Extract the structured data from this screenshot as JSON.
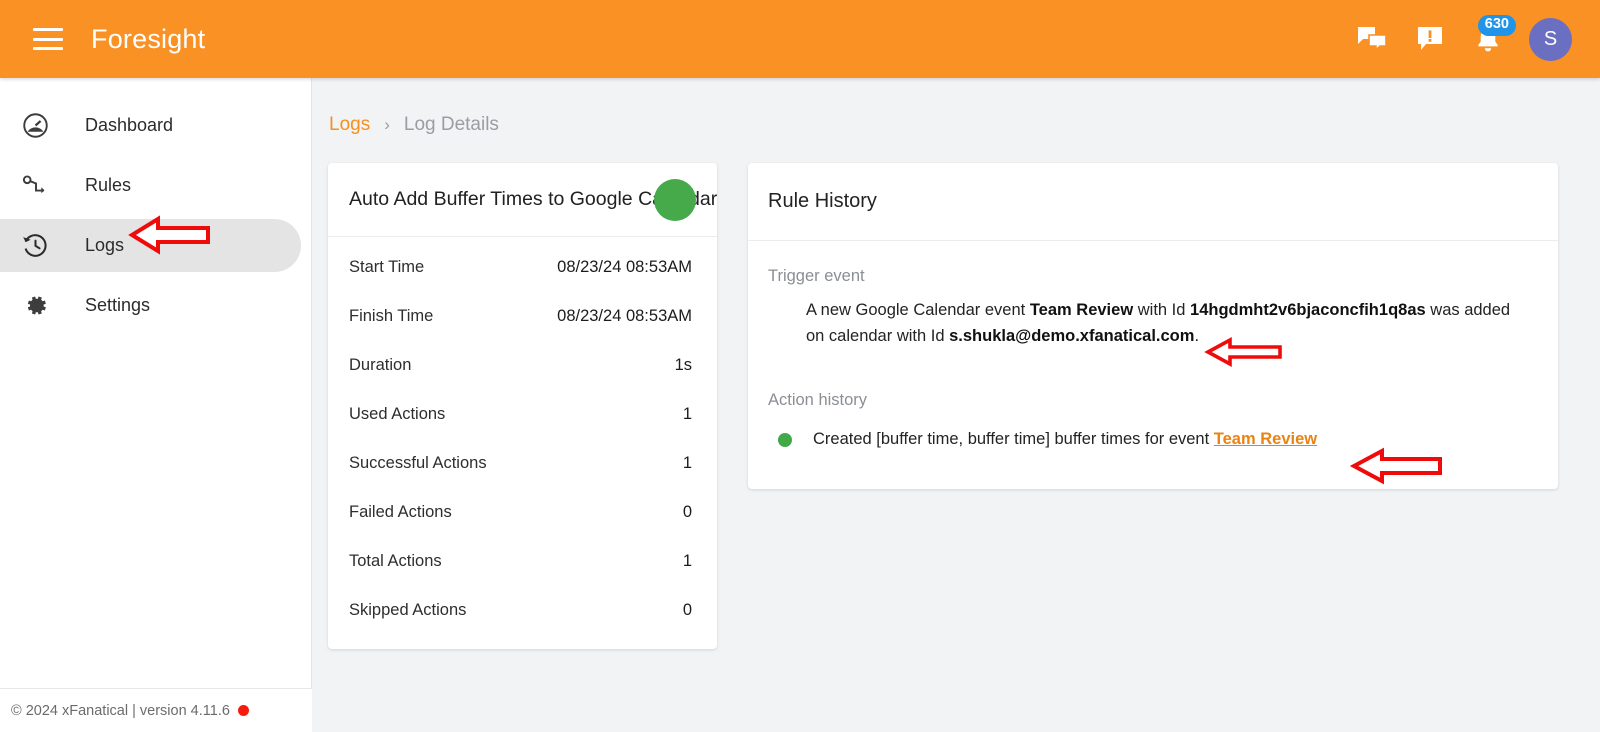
{
  "header": {
    "menu_icon": "hamburger-menu-icon",
    "title": "Foresight",
    "chat_icon": "forum-chat-icon",
    "feedback_icon": "feedback-alert-icon",
    "notifications_icon": "notification-bell-icon",
    "notifications_badge": "630",
    "avatar_initial": "S",
    "colors": {
      "bar": "#fa9124",
      "badge": "#2094e8",
      "avatar": "#6b6fc2"
    }
  },
  "sidebar": {
    "items": [
      {
        "label": "Dashboard",
        "icon": "speedometer-icon",
        "active": false
      },
      {
        "label": "Rules",
        "icon": "rule-flow-icon",
        "active": false
      },
      {
        "label": "Logs",
        "icon": "history-clock-icon",
        "active": true
      },
      {
        "label": "Settings",
        "icon": "gear-icon",
        "active": false
      }
    ],
    "footer": {
      "text": "© 2024 xFanatical | version 4.11.6",
      "dot_color": "#f51c0e"
    }
  },
  "breadcrumb": {
    "parent": "Logs",
    "separator": "›",
    "current": "Log Details"
  },
  "log_details": {
    "title": "Auto Add Buffer Times to Google Calendar Events",
    "status_color": "#46a94a",
    "rows": [
      {
        "key": "Start Time",
        "value": "08/23/24 08:53AM"
      },
      {
        "key": "Finish Time",
        "value": "08/23/24 08:53AM"
      },
      {
        "key": "Duration",
        "value": "1s"
      },
      {
        "key": "Used Actions",
        "value": "1"
      },
      {
        "key": "Successful Actions",
        "value": "1"
      },
      {
        "key": "Failed Actions",
        "value": "0"
      },
      {
        "key": "Total Actions",
        "value": "1"
      },
      {
        "key": "Skipped Actions",
        "value": "0"
      }
    ]
  },
  "rule_history": {
    "title": "Rule History",
    "trigger_label": "Trigger event",
    "trigger": {
      "part1": "A new Google Calendar event ",
      "event_name": "Team Review",
      "part2": " with Id ",
      "event_id": "14hgdmht2v6bjaconcfih1q8as",
      "part3": " was added on calendar with Id ",
      "calendar_id": "s.shukla@demo.xfanatical.com",
      "part4": "."
    },
    "action_label": "Action history",
    "action": {
      "status_color": "#42a948",
      "text": "Created [buffer time, buffer time] buffer times for event ",
      "link": "Team Review"
    }
  },
  "annotations": {
    "color": "#f00b0b",
    "arrows": [
      {
        "name": "arrow-pointing-to-logs-nav",
        "target": "Logs"
      },
      {
        "name": "arrow-pointing-to-trigger-event-text",
        "target": "Trigger event description"
      },
      {
        "name": "arrow-pointing-to-action-history-link",
        "target": "Team Review link"
      }
    ]
  }
}
